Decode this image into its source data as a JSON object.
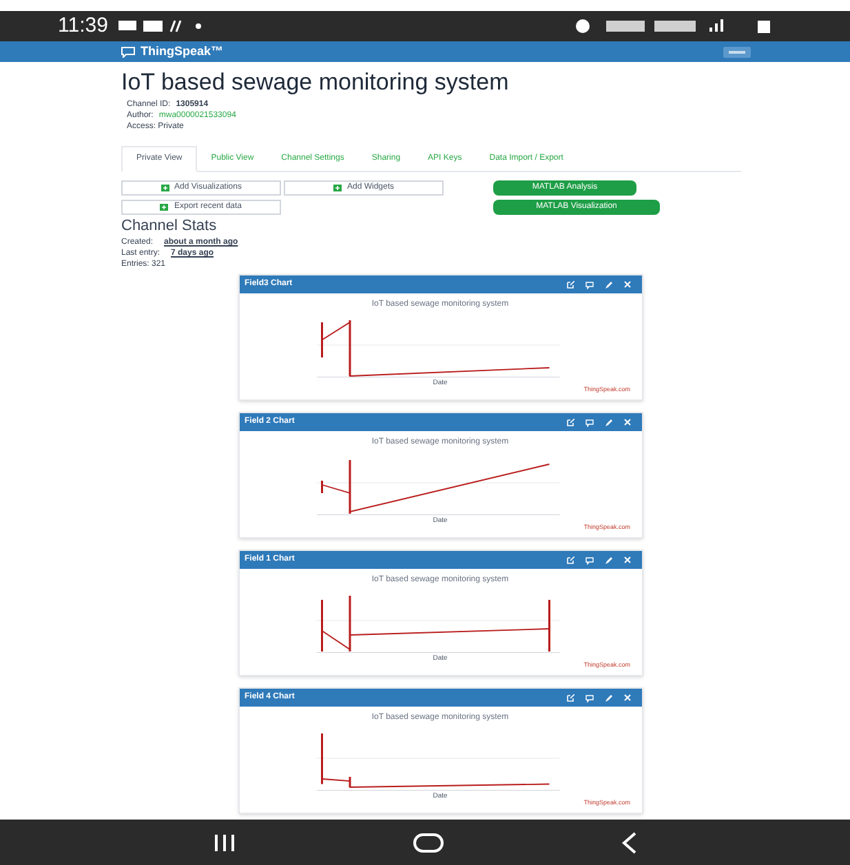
{
  "status_bar": {
    "time": "11:39"
  },
  "navbar": {
    "brand": "ThingSpeak™"
  },
  "channel": {
    "title": "IoT based sewage monitoring system",
    "id_label": "Channel ID:",
    "id": "1305914",
    "author_label": "Author:",
    "author": "mwa0000021533094",
    "access": "Access: Private"
  },
  "tabs": [
    {
      "label": "Private View",
      "selected": true
    },
    {
      "label": "Public View",
      "selected": false
    },
    {
      "label": "Channel Settings",
      "selected": false
    },
    {
      "label": "Sharing",
      "selected": false
    },
    {
      "label": "API Keys",
      "selected": false
    },
    {
      "label": "Data Import / Export",
      "selected": false
    }
  ],
  "left_buttons": [
    {
      "label": "Add Visualizations"
    },
    {
      "label": "Add Widgets"
    },
    {
      "label": "Export recent data"
    }
  ],
  "right_buttons": [
    {
      "label": "MATLAB Analysis"
    },
    {
      "label": "MATLAB Visualization"
    }
  ],
  "stats": {
    "title": "Channel Stats",
    "created_label": "Created:",
    "created": "about a month ago",
    "last_label": "Last entry:",
    "last": "7 days ago",
    "entries": "Entries: 321"
  },
  "charts": [
    {
      "header": "Field3 Chart",
      "title": "IoT based sewage monitoring system",
      "xlabel": "Date",
      "credit": "ThingSpeak.com"
    },
    {
      "header": "Field 2 Chart",
      "title": "IoT based sewage monitoring system",
      "xlabel": "Date",
      "credit": "ThingSpeak.com"
    },
    {
      "header": "Field 1 Chart",
      "title": "IoT based sewage monitoring system",
      "xlabel": "Date",
      "credit": "ThingSpeak.com"
    },
    {
      "header": "Field 4 Chart",
      "title": "IoT based sewage monitoring system",
      "xlabel": "Date",
      "credit": "ThingSpeak.com"
    }
  ]
}
